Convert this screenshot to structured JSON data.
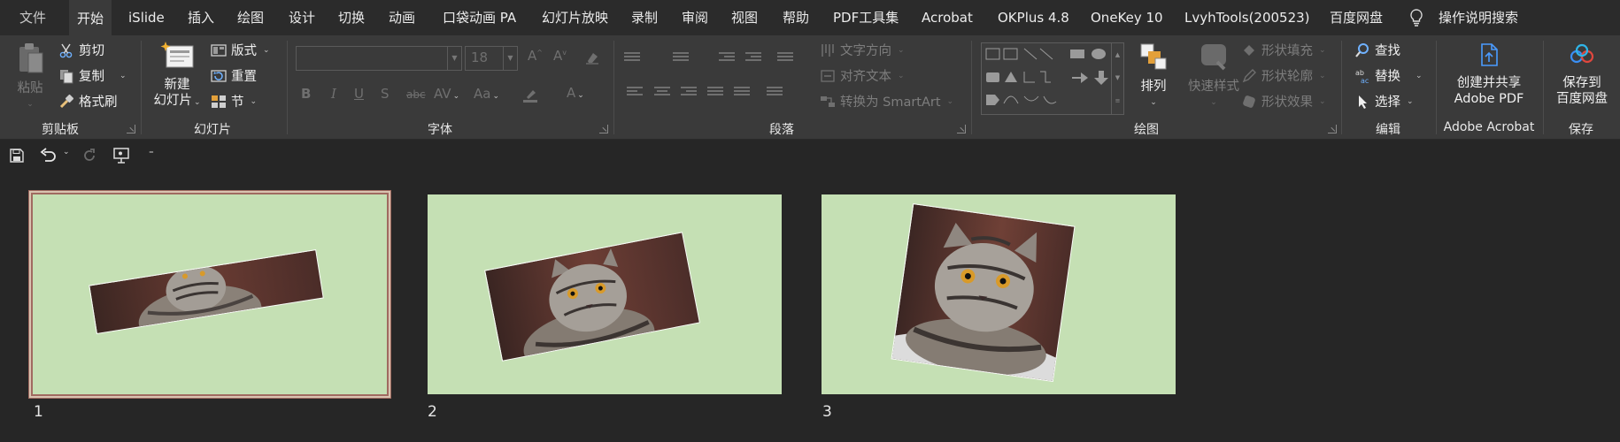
{
  "menu": {
    "tabs": [
      "文件",
      "开始",
      "iSlide",
      "插入",
      "绘图",
      "设计",
      "切换",
      "动画",
      "口袋动画 PA",
      "幻灯片放映",
      "录制",
      "审阅",
      "视图",
      "帮助",
      "PDF工具集",
      "Acrobat",
      "OKPlus 4.8",
      "OneKey 10",
      "LvyhTools(200523)",
      "百度网盘"
    ],
    "active_tab": "开始",
    "search_label": "操作说明搜索"
  },
  "ribbon": {
    "clipboard": {
      "paste": "粘贴",
      "cut": "剪切",
      "copy": "复制",
      "format_painter": "格式刷",
      "group": "剪贴板"
    },
    "slides": {
      "new_slide_line1": "新建",
      "new_slide_line2": "幻灯片",
      "layout": "版式",
      "reset": "重置",
      "section": "节",
      "group": "幻灯片"
    },
    "font": {
      "font_size": "18",
      "group": "字体"
    },
    "paragraph": {
      "text_direction": "文字方向",
      "align_text": "对齐文本",
      "convert_smartart": "转换为 SmartArt",
      "group": "段落"
    },
    "drawing": {
      "arrange": "排列",
      "quick_styles": "快速样式",
      "shape_fill": "形状填充",
      "shape_outline": "形状轮廓",
      "shape_effects": "形状效果",
      "group": "绘图"
    },
    "editing": {
      "find": "查找",
      "replace": "替换",
      "select": "选择",
      "group": "编辑"
    },
    "acrobat": {
      "create_line1": "创建并共享",
      "create_line2": "Adobe PDF",
      "group": "Adobe Acrobat"
    },
    "save": {
      "save_line1": "保存到",
      "save_line2": "百度网盘",
      "group": "保存"
    }
  },
  "slides": [
    {
      "number": "1",
      "selected": true
    },
    {
      "number": "2",
      "selected": false
    },
    {
      "number": "3",
      "selected": false
    }
  ],
  "colors": {
    "slide_background": "#c5e0b4",
    "ribbon": "#3a3a3a",
    "app_background": "#262626",
    "selection_border": "#a06a60"
  }
}
